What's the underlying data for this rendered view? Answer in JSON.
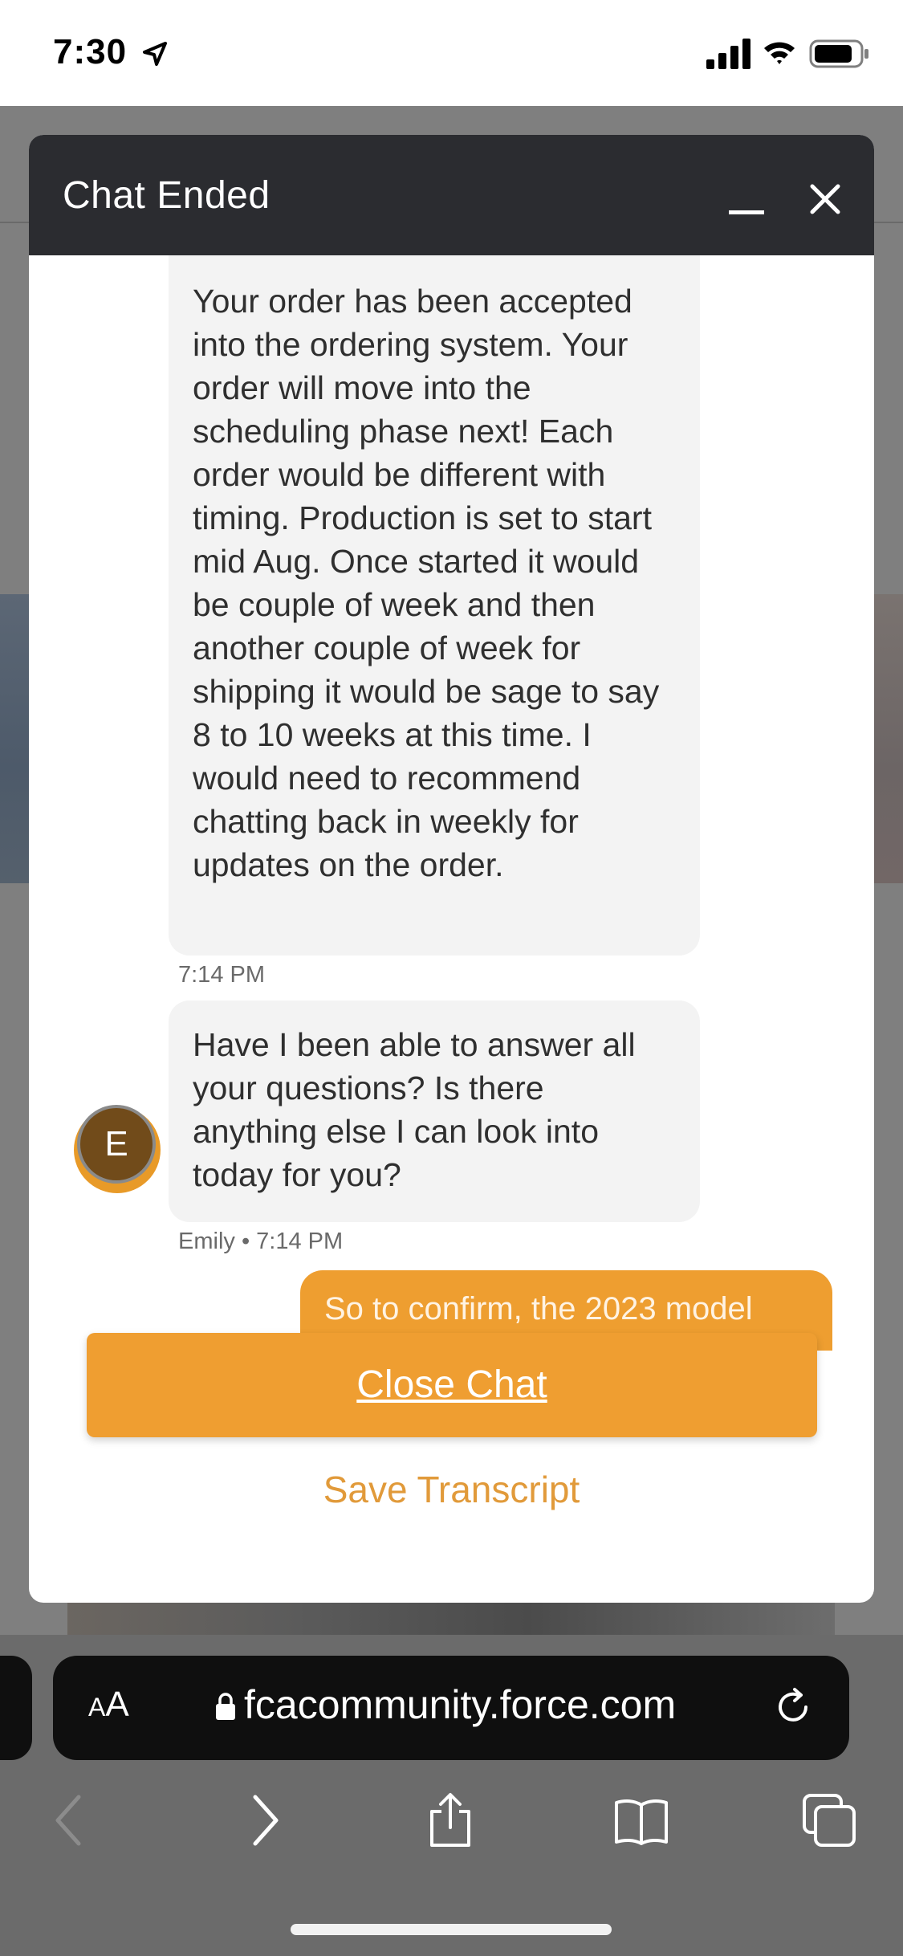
{
  "status_bar": {
    "time": "7:30",
    "icons": [
      "location-arrow-icon",
      "cellular-signal-icon",
      "wifi-icon",
      "battery-icon"
    ]
  },
  "chat": {
    "header_title": "Chat Ended",
    "minimize_icon": "minimize-icon",
    "close_icon": "close-icon",
    "messages": [
      {
        "sender": "agent",
        "text": "Your order has been accepted into the ordering system. Your order will move into the scheduling phase next! Each order would be different with timing. Production is set to start mid Aug. Once started it would be couple of week and then another couple of week for shipping it would be sage to say 8 to 10 weeks at this time. I would need to recommend chatting back in weekly for updates on the order.",
        "timestamp": "7:14 PM"
      },
      {
        "sender": "agent",
        "text": "Have I been able to answer all your questions? Is there anything else I can look into today for you?",
        "meta": "Emily • 7:14 PM",
        "avatar_initial": "E"
      },
      {
        "sender": "user",
        "text": "So to confirm, the 2023 model"
      }
    ],
    "close_button_label": "Close Chat",
    "save_transcript_label": "Save Transcript"
  },
  "browser": {
    "text_size_label_big": "A",
    "text_size_label_small": "A",
    "url": "fcacommunity.force.com",
    "toolbar": [
      "back-icon",
      "forward-icon",
      "share-icon",
      "bookmarks-icon",
      "tabs-icon"
    ]
  },
  "colors": {
    "accent": "#ef9e31",
    "header": "#2b2c30",
    "agent_bubble": "#f3f3f3"
  }
}
